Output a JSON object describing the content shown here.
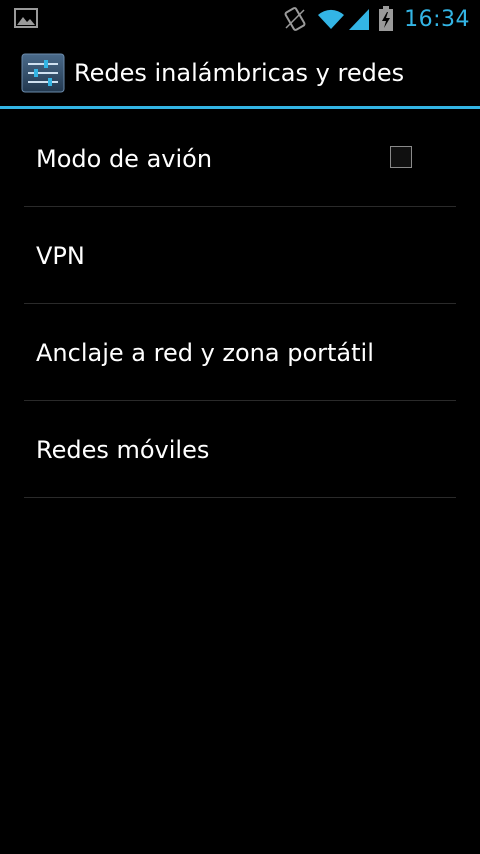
{
  "status_bar": {
    "time": "16:34",
    "icons": [
      "image-notification-icon",
      "screen-rotation-icon",
      "wifi-icon",
      "signal-icon",
      "battery-charging-icon"
    ],
    "accent_color": "#33b5e5"
  },
  "action_bar": {
    "title": "Redes inalámbricas y redes",
    "icon": "settings-sliders-icon"
  },
  "settings_list": {
    "items": [
      {
        "label": "Modo de avión",
        "has_checkbox": true,
        "checked": false
      },
      {
        "label": "VPN"
      },
      {
        "label": "Anclaje a red y zona portátil"
      },
      {
        "label": "Redes móviles"
      }
    ]
  }
}
